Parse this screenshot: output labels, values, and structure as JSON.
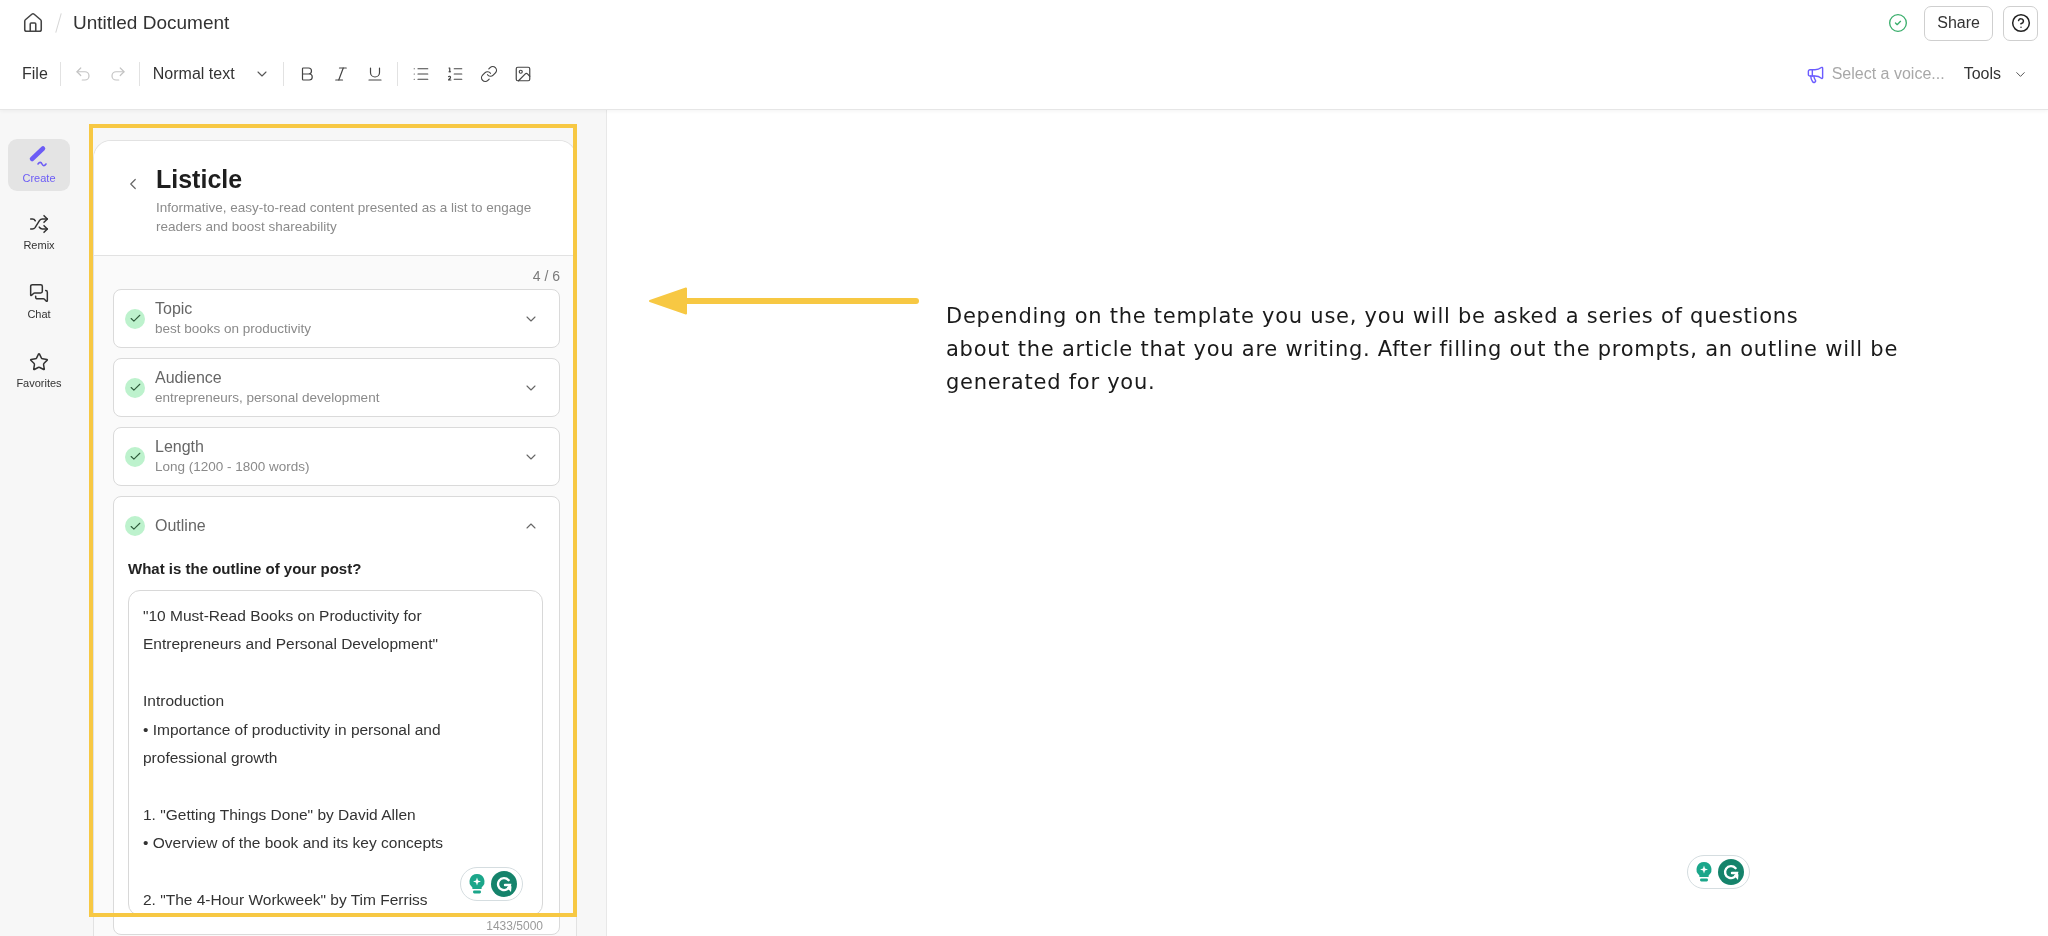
{
  "header": {
    "title": "Untitled Document",
    "saved": true,
    "share_button": "Share"
  },
  "toolbar": {
    "file_menu": "File",
    "undo": {
      "disabled": true
    },
    "redo": {
      "disabled": true
    },
    "text_style": "Normal text",
    "voice_select": {
      "placeholder": "Select a voice..."
    },
    "tools_menu": "Tools"
  },
  "rail": {
    "items": [
      {
        "label": "Create",
        "selected": true
      },
      {
        "label": "Remix",
        "selected": false
      },
      {
        "label": "Chat",
        "selected": false
      },
      {
        "label": "Favorites",
        "selected": false
      }
    ]
  },
  "panel": {
    "title": "Listicle",
    "description": "Informative, easy-to-read content presented as a list to engage readers and boost shareability",
    "step_count": "4 / 6",
    "steps": [
      {
        "title": "Topic",
        "value": "best books on productivity",
        "completed": true,
        "expanded": false
      },
      {
        "title": "Audience",
        "value": "entrepreneurs, personal development",
        "completed": true,
        "expanded": false
      },
      {
        "title": "Length",
        "value": "Long (1200 - 1800 words)",
        "completed": true,
        "expanded": false
      },
      {
        "title": "Outline",
        "completed": true,
        "expanded": true,
        "question": "What is the outline of your post?",
        "answer": "\"10 Must-Read Books on Productivity for Entrepreneurs and Personal Development\"\n\nIntroduction\n• Importance of productivity in personal and professional growth\n\n1. \"Getting Things Done\" by David Allen\n• Overview of the book and its key concepts\n\n2. \"The 4-Hour Workweek\" by Tim Ferriss",
        "counter": "1433/5000"
      }
    ]
  },
  "annotation": {
    "text": "Depending on the template you use, you will be asked a series of questions\nabout the article that you are writing. After filling out the prompts, an outline will be\ngenerated for you."
  }
}
